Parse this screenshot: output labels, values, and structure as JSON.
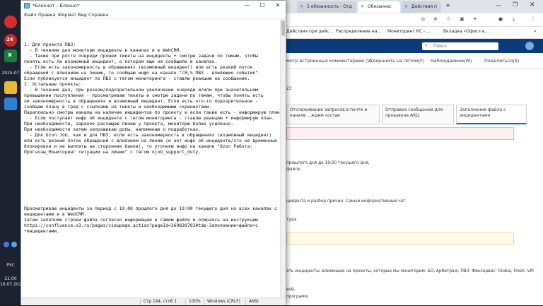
{
  "taskbar": {
    "badge_count": "24",
    "date_short": "2025-07",
    "lang": "РУС",
    "time": "21:00",
    "date": "16.07.2025"
  },
  "notepad": {
    "title": "*Блокнот – Блокнот",
    "menu": [
      "Файл",
      "Правка",
      "Формат",
      "Вид",
      "Справка"
    ],
    "lines": [
      "1. Для проекта ПВЗ:",
      "  - В течение дня мониторю инциденты в каналах и в WebCRM.",
      "  - Также при росте очереди прошеи тикеты на инциденты + смотрю задачи по темам, чтобы",
      "понять есть ли возможный инцидент, о котором еще не сообщили в каналах.",
      "  - Если есть закономерность в обращениях (возможный инцидент) или есть резкий поток",
      "обращений с влиянием на линию, то сообщаю инфо на канале \"СЯ,% ПВЗ - влияющие события\".",
      "Если публикуется инцидент по ПВЗ с тегом мониторинга - ставлю реакцию на сообщение.",
      "2. Остальные проекты:",
      "  - В течение дня, при резком/подозрительном увеличении очереди и/или при значительном",
      "превышении послупления - просматриваю тикеты и смотрю задачи по темам, чтобы понять есть",
      "ли закономерность в обращениях и возможный инцидент. Если есть что-то подозрительное -",
      "сообщаю плану в тред с ссылками на тикеты и необходимыми скриншотами.",
      "Параллельно смотрю каналы на наличие инцидентов по проекту и если такие есть - информирую план.",
      "  - Если поступает инфо об инциденте с тегом мониторинга - ставлю реакцию + информирую план.",
      "При необходимости, заранее расчищаю линию у проекта, мониторю более усиленно.",
      "При необходимости затем запрашиваю допы, напоминаю о подработках.",
      "  - Для Ozon Job, как и для ПВЗ, если есть закономерность в обращениях (возможный инцидент)",
      "или есть резкий поток обращений с влиянием на линию (и нет инфо об инциденте/это не временные",
      "блокировки и не выплаты на сторонние банки), то уточняю инфо на канале \"Ozon Работа:",
      "Прогнозы_Мониторинг ситуации на линии\" с тегом ojob_support_duty.",
      "",
      "",
      "",
      "",
      "",
      "",
      "",
      "",
      "",
      "Просматриваю инциденты за период с 19.00 прошлого дня до 19:00 текущего дня на всех каналах с",
      "инцидентами и в WebCRM.",
      "Затем заполняю строки файла согласно информации в самом файле и опираясь на инструкцию",
      "https://confluence.o3.ru/pages/viewpage.action?pageId=369830703#tab-Заполнение+файла+с",
      "+инцидентами."
    ],
    "status": {
      "position": "Стр 194, стлб 1",
      "zoom": "100%",
      "eol": "Windows (CRLF)",
      "encoding": "ANSI"
    }
  },
  "browser": {
    "tabs": [
      "5 обязанность - Отд",
      "Обязаннос",
      "Действия п"
    ],
    "bookmarks": [
      "Действия при дейс...",
      "Распределение на...",
      "Мониторинг КС - ...",
      "Вкладка «Офис» в..."
    ],
    "search_placeholder": "Поиск",
    "toolbar": [
      "мотр встроенных комментариев (V)",
      "Сохранить на потом(F)",
      "Наблюдаемое(W)",
      "Поделиться(S)"
    ],
    "counter": "23",
    "page_tabs": [
      "Отслеживание запросов в почте и канале ...ждем состав",
      "Отправка сообщений для проазвона АКЦ",
      "Заполнение файла с инцидентами"
    ],
    "body_lines": [
      "прошлого дня до 19:00 текущего дня,",
      "файле",
      "щидента и разбор причин. Самый информативный чат",
      "туда",
      "ать инциденты, влияющие на проекты, которые мы мониторим: БО, Арбитраж, ПВЗ, Финсервис, Global, Fresh, VIP.",
      "вой,",
      "программ,"
    ]
  }
}
